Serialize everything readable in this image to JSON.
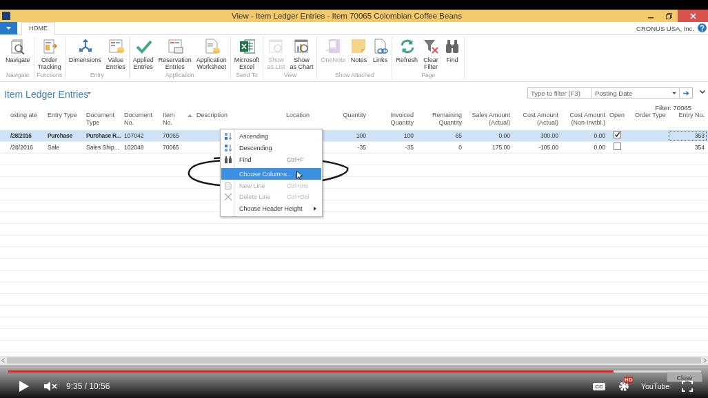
{
  "window": {
    "title": "View - Item Ledger Entries - Item 70065 Colombian Coffee Beans"
  },
  "ribbon": {
    "tabs": [
      {
        "label": "HOME",
        "selected": true
      }
    ],
    "company": "CRONUS USA, Inc.",
    "groups": [
      {
        "label": "Navigate",
        "buttons": [
          {
            "label": "Navigate",
            "disabled": false
          }
        ]
      },
      {
        "label": "Functions",
        "buttons": [
          {
            "label": "Order Tracking",
            "disabled": false
          }
        ]
      },
      {
        "label": "Entry",
        "buttons": [
          {
            "label": "Dimensions",
            "disabled": false
          },
          {
            "label": "Value Entries",
            "disabled": false
          }
        ]
      },
      {
        "label": "Application",
        "buttons": [
          {
            "label": "Applied Entries",
            "disabled": false
          },
          {
            "label": "Reservation Entries",
            "disabled": false
          },
          {
            "label": "Application Worksheet",
            "disabled": false
          }
        ]
      },
      {
        "label": "Send To",
        "buttons": [
          {
            "label": "Microsoft Excel",
            "disabled": false
          }
        ]
      },
      {
        "label": "View",
        "buttons": [
          {
            "label": "Show as List",
            "disabled": true
          },
          {
            "label": "Show as Chart",
            "disabled": false
          }
        ]
      },
      {
        "label": "Show Attached",
        "buttons": [
          {
            "label": "OneNote",
            "disabled": true
          },
          {
            "label": "Notes",
            "disabled": false
          },
          {
            "label": "Links",
            "disabled": false
          }
        ]
      },
      {
        "label": "Page",
        "buttons": [
          {
            "label": "Refresh",
            "disabled": false
          },
          {
            "label": "Clear Filter",
            "disabled": false
          },
          {
            "label": "Find",
            "disabled": false
          }
        ]
      }
    ]
  },
  "page": {
    "title": "Item Ledger Entries",
    "filter_field": {
      "placeholder": "Type to filter (F3)"
    },
    "filter_column": "Posting Date",
    "filter_text": "Filter: 70065"
  },
  "table": {
    "columns": [
      {
        "label": "osting ate",
        "kind": "text"
      },
      {
        "label": "Entry Type",
        "kind": "text"
      },
      {
        "label": "Document Type",
        "kind": "text"
      },
      {
        "label": "Document No.",
        "kind": "text"
      },
      {
        "label": "Item No.",
        "kind": "text"
      },
      {
        "label": "Description",
        "kind": "text",
        "sorted": true
      },
      {
        "label": "Location",
        "kind": "text"
      },
      {
        "label": "Quantity",
        "kind": "number"
      },
      {
        "label": "Invoiced Quantity",
        "kind": "number"
      },
      {
        "label": "Remaining Quantity",
        "kind": "number"
      },
      {
        "label": "Sales Amount (Actual)",
        "kind": "number"
      },
      {
        "label": "Cost Amount (Actual)",
        "kind": "number"
      },
      {
        "label": "Cost Amount (Non-Invtbl.)",
        "kind": "number"
      },
      {
        "label": "Open",
        "kind": "check"
      },
      {
        "label": "Order Type",
        "kind": "text"
      },
      {
        "label": "Entry No.",
        "kind": "number"
      }
    ],
    "rows": [
      {
        "selected": true,
        "focused": true,
        "open": true,
        "cells": [
          "/28/2016",
          "Purchase",
          "Purchase R...",
          "107042",
          "70065",
          null,
          null,
          "100",
          "100",
          "65",
          "0.00",
          "300.00",
          "0.00",
          null,
          "353"
        ]
      },
      {
        "selected": false,
        "focused": false,
        "open": false,
        "cells": [
          "/28/2016",
          "Sale",
          "Sales Ship...",
          "102048",
          "70065",
          null,
          null,
          "-35",
          "-35",
          "0",
          "175.00",
          "-105.00",
          "0.00",
          null,
          "354"
        ]
      }
    ]
  },
  "context_menu": {
    "items": [
      {
        "label": "Ascending",
        "selected": false,
        "disabled": false
      },
      {
        "label": "Descending",
        "selected": false,
        "disabled": false
      },
      {
        "label": "Find",
        "shortcut": "Ctrl+F",
        "selected": false,
        "disabled": false
      },
      {
        "label": "Choose Columns...",
        "selected": true,
        "disabled": false
      },
      {
        "label": "New Line",
        "shortcut": "Ctrl+Ins",
        "selected": false,
        "disabled": true
      },
      {
        "label": "Delete Line",
        "shortcut": "Ctrl+Del",
        "selected": false,
        "disabled": true
      },
      {
        "label": "Choose Header Height",
        "submenu": true,
        "selected": false,
        "disabled": false
      }
    ]
  },
  "close_button": "Close",
  "player": {
    "level": 0.874,
    "time": "9:35 / 10:56",
    "cc": "CC",
    "hd": "HD",
    "logo": "YouTube"
  }
}
